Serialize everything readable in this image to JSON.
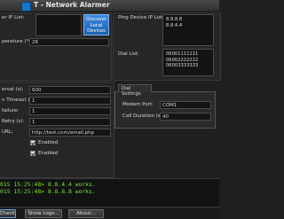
{
  "window": {
    "title": "T - Network Alarmer"
  },
  "left_top": {
    "server_ip_label": "er IP List:",
    "discover_button": "Discover Local Devices",
    "temperature_label": "perature (°C):",
    "temperature_value": "26"
  },
  "right_top": {
    "ping_label": "Ping Device IP List:",
    "ping_ips": [
      "8.8.8.8",
      "8.8.4.4"
    ],
    "dial_label": "Dial List:",
    "dial_numbers": [
      "06001111111",
      "06002222222",
      "06003333333"
    ]
  },
  "settings": {
    "interval_label": "erval (s):",
    "interval_value": "600",
    "timeout_label": "n Timeout (s):",
    "timeout_value": "1",
    "failure_label": "failure:",
    "failure_value": "1",
    "retry_label": "Retry (s):",
    "retry_value": "1",
    "url_label": "URL:",
    "url_value": "http://test.com/email.php",
    "enabled1_label": "Enabled",
    "enabled2_label": "Enabled"
  },
  "dial_settings": {
    "tab_label": "Dial Settings",
    "modem_label": "Modem Port:",
    "modem_value": "COM1",
    "duration_label": "Call Duration (s):",
    "duration_value": "40"
  },
  "log": {
    "lines": [
      "015 15:25:48> 8.8.4.4 works.",
      "015 15:25:48> 8.8.8.8 works."
    ]
  },
  "buttons": {
    "check": "Check",
    "show_logs": "Show Logs...",
    "about": "About..."
  }
}
